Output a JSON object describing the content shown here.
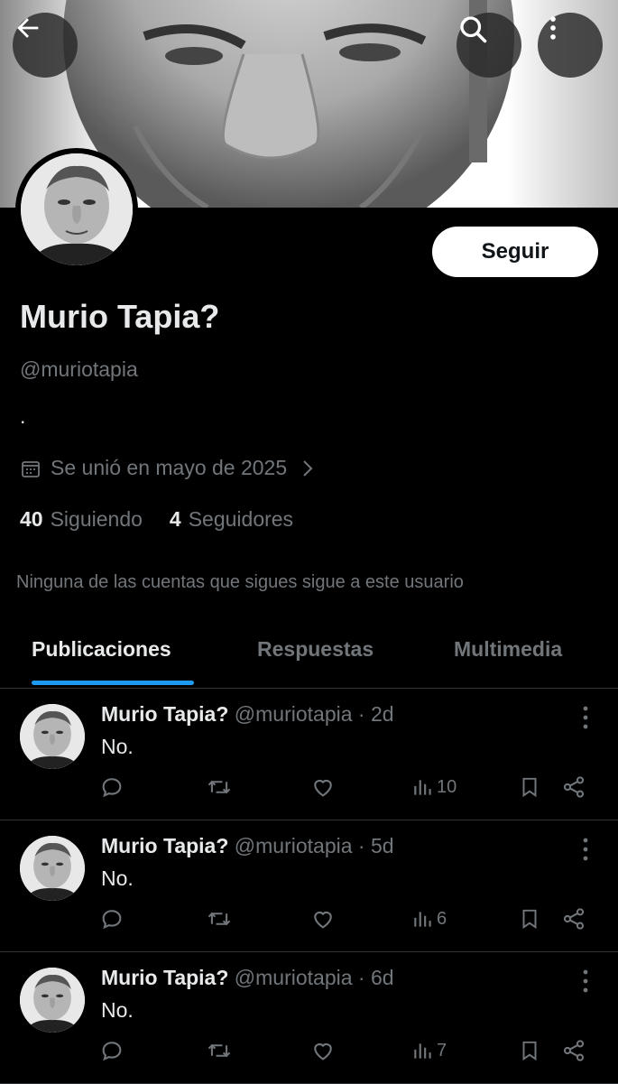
{
  "header": {
    "back_icon": "arrow-left-icon",
    "search_icon": "search-icon",
    "more_icon": "more-vertical-icon"
  },
  "profile": {
    "follow_label": "Seguir",
    "display_name": "Murio Tapia?",
    "handle": "@muriotapia",
    "bio": ".",
    "joined": "Se unió en mayo de 2025",
    "following_count": "40",
    "following_label": "Siguiendo",
    "followers_count": "4",
    "followers_label": "Seguidores",
    "mutual_note": "Ninguna de las cuentas que sigues sigue a este usuario"
  },
  "tabs": [
    {
      "label": "Publicaciones",
      "active": true
    },
    {
      "label": "Respuestas",
      "active": false
    },
    {
      "label": "Multimedia",
      "active": false
    }
  ],
  "posts": [
    {
      "name": "Murio Tapia?",
      "handle": "@muriotapia",
      "time": "· 2d",
      "text": "No.",
      "views": "10"
    },
    {
      "name": "Murio Tapia?",
      "handle": "@muriotapia",
      "time": "· 5d",
      "text": "No.",
      "views": "6"
    },
    {
      "name": "Murio Tapia?",
      "handle": "@muriotapia",
      "time": "· 6d",
      "text": "No.",
      "views": "7"
    }
  ],
  "colors": {
    "background": "#000000",
    "text_primary": "#e7e9ea",
    "text_secondary": "#71767b",
    "accent": "#1d9bf0",
    "divider": "#2f3336"
  }
}
